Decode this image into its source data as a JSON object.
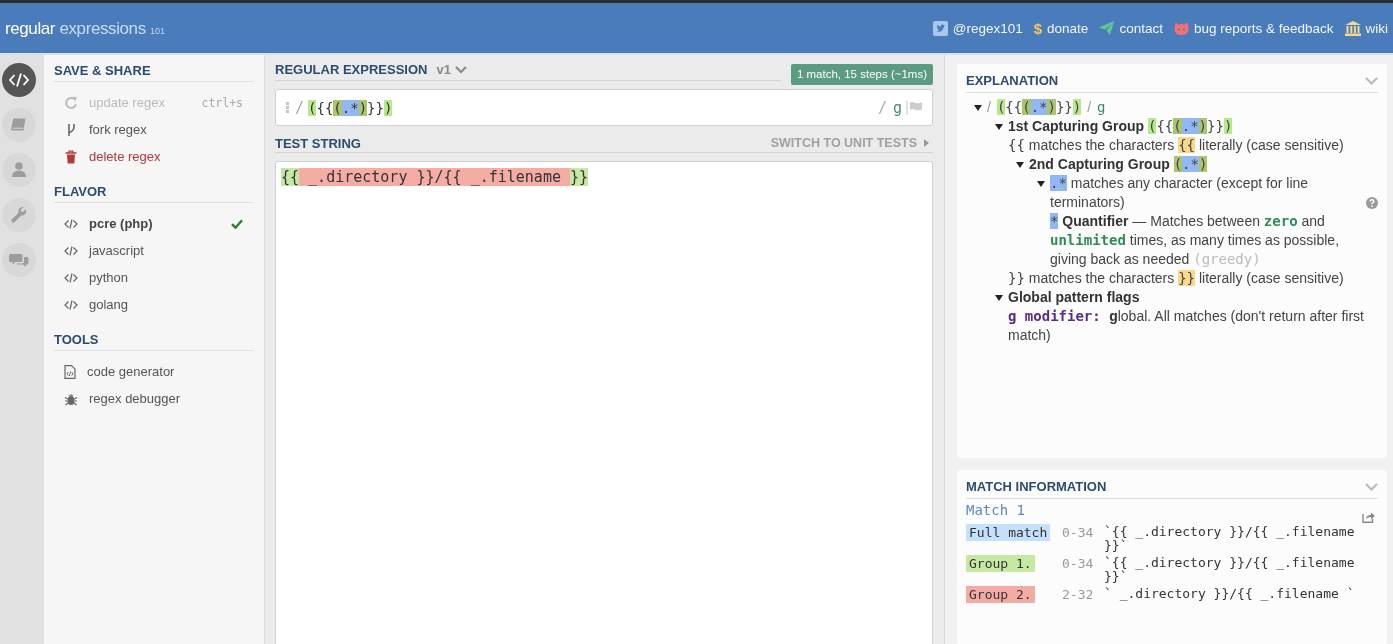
{
  "header": {
    "logo": {
      "primary": "regular",
      "secondary": "expressions",
      "version": "101"
    },
    "links": [
      {
        "kind": "social",
        "label": "@regex101"
      },
      {
        "kind": "donate",
        "symbol": "$",
        "label": "donate"
      },
      {
        "kind": "contact",
        "label": "contact"
      },
      {
        "kind": "issues",
        "label": "bug reports & feedback"
      },
      {
        "kind": "docs",
        "label": "wiki"
      }
    ]
  },
  "nav_rail": [
    {
      "kind": "editor",
      "selected": true
    },
    {
      "kind": "library",
      "selected": false
    },
    {
      "kind": "account",
      "selected": false
    },
    {
      "kind": "tools",
      "selected": false
    },
    {
      "kind": "chat",
      "selected": false
    }
  ],
  "sidebar": {
    "save_share": {
      "title": "SAVE & SHARE",
      "items": [
        {
          "kind": "update",
          "label": "update regex",
          "shortcut": "ctrl+s",
          "disabled": true
        },
        {
          "kind": "fork",
          "label": "fork regex",
          "disabled": false
        },
        {
          "kind": "delete",
          "label": "delete regex",
          "disabled": false
        }
      ]
    },
    "flavor": {
      "title": "FLAVOR",
      "items": [
        {
          "label": "pcre (php)",
          "selected": true
        },
        {
          "label": "javascript",
          "selected": false
        },
        {
          "label": "python",
          "selected": false
        },
        {
          "label": "golang",
          "selected": false
        }
      ]
    },
    "tools": {
      "title": "TOOLS",
      "items": [
        {
          "kind": "generator",
          "label": "code generator"
        },
        {
          "kind": "debugger",
          "label": "regex debugger"
        }
      ]
    }
  },
  "regex_editor": {
    "title": "REGULAR EXPRESSION",
    "version": "v1",
    "status": "1 match, 15 steps (~1ms)",
    "delimiter": "/",
    "pattern": [
      {
        "text": "(",
        "kind": "group"
      },
      {
        "text": "{{",
        "kind": "plain"
      },
      {
        "text": "(",
        "kind": "subgroup"
      },
      {
        "text": ".*",
        "kind": "meta"
      },
      {
        "text": ")",
        "kind": "subgroup"
      },
      {
        "text": "}}",
        "kind": "plain"
      },
      {
        "text": ")",
        "kind": "group"
      }
    ],
    "closing_delimiter": "/",
    "flags": "g"
  },
  "test_string": {
    "title": "TEST STRING",
    "action": "SWITCH TO UNIT TESTS",
    "segments": [
      {
        "text": "{{",
        "kind": "group1"
      },
      {
        "text": " _.directory }}/{{ _.filename ",
        "kind": "group2"
      },
      {
        "text": "}}",
        "kind": "group1"
      }
    ]
  },
  "explanation": {
    "title": "EXPLANATION",
    "tree": [
      {
        "kind": "branch",
        "expanded": true,
        "segments": [
          {
            "text": "/",
            "kind": "delim"
          },
          {
            "text": "(",
            "kind": "group"
          },
          {
            "text": "{{",
            "kind": "plain"
          },
          {
            "text": "(",
            "kind": "subgroup"
          },
          {
            "text": ".*",
            "kind": "meta"
          },
          {
            "text": ")",
            "kind": "subgroup"
          },
          {
            "text": "}}",
            "kind": "plain"
          },
          {
            "text": ")",
            "kind": "group"
          },
          {
            "text": "/",
            "kind": "delim"
          },
          {
            "text": "g",
            "kind": "flag"
          }
        ],
        "children": [
          {
            "kind": "branch",
            "expanded": true,
            "segments": [
              {
                "text": "1st Capturing Group ",
                "kind": "strong"
              },
              {
                "text": "(",
                "kind": "group"
              },
              {
                "text": "{{",
                "kind": "plain"
              },
              {
                "text": "(",
                "kind": "subgroup"
              },
              {
                "text": ".*",
                "kind": "meta"
              },
              {
                "text": ")",
                "kind": "subgroup"
              },
              {
                "text": "}}",
                "kind": "plain"
              },
              {
                "text": ")",
                "kind": "group"
              }
            ],
            "children": [
              {
                "kind": "leaf",
                "segments": [
                  {
                    "text": "{{",
                    "kind": "code"
                  },
                  {
                    "text": " matches the characters ",
                    "kind": "text"
                  },
                  {
                    "text": "{{",
                    "kind": "literal"
                  },
                  {
                    "text": " literally (case sensitive)",
                    "kind": "text"
                  }
                ]
              },
              {
                "kind": "branch",
                "expanded": true,
                "segments": [
                  {
                    "text": "2nd Capturing Group ",
                    "kind": "strong"
                  },
                  {
                    "text": "(",
                    "kind": "subgroup"
                  },
                  {
                    "text": ".*",
                    "kind": "meta"
                  },
                  {
                    "text": ")",
                    "kind": "subgroup"
                  }
                ],
                "children": [
                  {
                    "kind": "branch",
                    "expanded": true,
                    "help": true,
                    "segments": [
                      {
                        "text": ".*",
                        "kind": "meta"
                      },
                      {
                        "text": " matches any character (except for line terminators)",
                        "kind": "text"
                      }
                    ],
                    "children": [
                      {
                        "kind": "leaf",
                        "segments": [
                          {
                            "text": "*",
                            "kind": "meta"
                          },
                          {
                            "text": " Quantifier",
                            "kind": "strong"
                          },
                          {
                            "text": " — Matches between ",
                            "kind": "text"
                          },
                          {
                            "text": "zero",
                            "kind": "value"
                          },
                          {
                            "text": " and ",
                            "kind": "text"
                          },
                          {
                            "text": "unlimited",
                            "kind": "value"
                          },
                          {
                            "text": " times, as many times as possible, giving back as needed ",
                            "kind": "text"
                          },
                          {
                            "text": "(greedy)",
                            "kind": "muted"
                          }
                        ]
                      }
                    ]
                  }
                ]
              },
              {
                "kind": "leaf",
                "segments": [
                  {
                    "text": "}}",
                    "kind": "code"
                  },
                  {
                    "text": " matches the characters ",
                    "kind": "text"
                  },
                  {
                    "text": "}}",
                    "kind": "literal"
                  },
                  {
                    "text": " literally (case sensitive)",
                    "kind": "text"
                  }
                ]
              }
            ]
          },
          {
            "kind": "branch",
            "expanded": true,
            "segments": [
              {
                "text": "Global pattern flags",
                "kind": "strong"
              }
            ],
            "children": [
              {
                "kind": "leaf",
                "segments": [
                  {
                    "text": "g modifier: ",
                    "kind": "modifier"
                  },
                  {
                    "text": "g",
                    "kind": "strong"
                  },
                  {
                    "text": "lobal. All matches (don't return after first match)",
                    "kind": "text"
                  }
                ]
              }
            ]
          }
        ]
      }
    ]
  },
  "match_information": {
    "title": "MATCH INFORMATION",
    "match_label": "Match 1",
    "rows": [
      {
        "label": "Full match",
        "range": "0-34",
        "value": "`{{ _.directory }}/{{ _.filename }}`",
        "color": "#c4e0fa"
      },
      {
        "label": "Group 1.",
        "range": "0-34",
        "value": "`{{ _.directory }}/{{ _.filename }}`",
        "color": "#c6e8a2"
      },
      {
        "label": "Group 2.",
        "range": "2-32",
        "value": "` _.directory }}/{{ _.filename `",
        "color": "#f4aba3"
      }
    ]
  }
}
